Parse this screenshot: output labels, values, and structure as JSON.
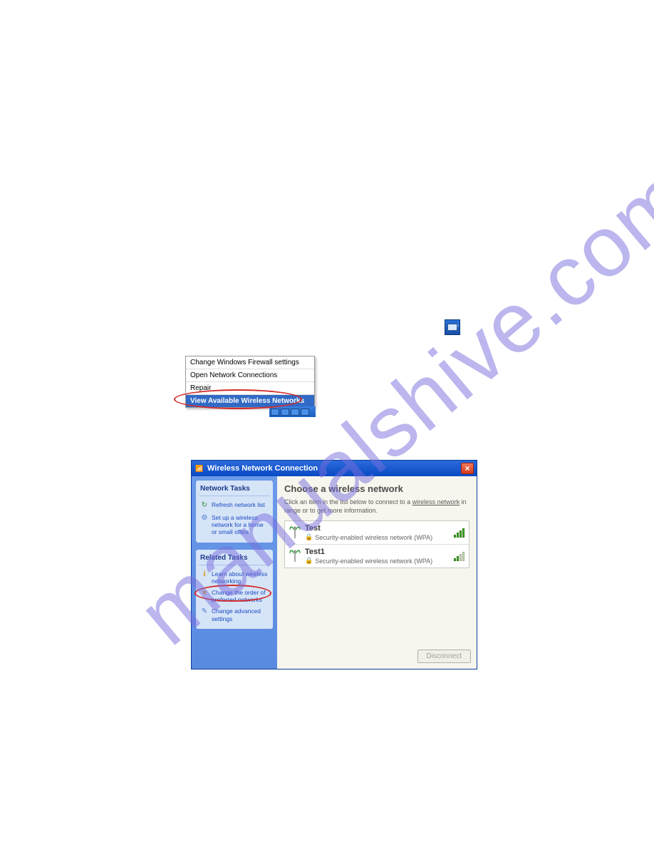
{
  "tray_icon": {
    "name": "wireless-tray-icon"
  },
  "context_menu": {
    "items": [
      {
        "label": "Change Windows Firewall settings",
        "selected": false
      },
      {
        "label": "Open Network Connections",
        "selected": false
      },
      {
        "label": "Repair",
        "selected": false
      },
      {
        "label": "View Available Wireless Networks",
        "selected": true
      }
    ]
  },
  "dialog": {
    "title": "Wireless Network Connection",
    "close_label": "×",
    "sidebar": {
      "network_tasks_title": "Network Tasks",
      "network_tasks": [
        {
          "icon": "refresh-icon",
          "label": "Refresh network list"
        },
        {
          "icon": "setup-icon",
          "label": "Set up a wireless network for a home or small office"
        }
      ],
      "related_tasks_title": "Related Tasks",
      "related_tasks": [
        {
          "icon": "info-icon",
          "label": "Learn about wireless networking"
        },
        {
          "icon": "star-icon",
          "label": "Change the order of preferred networks",
          "highlighted": true
        },
        {
          "icon": "gear-icon",
          "label": "Change advanced settings"
        }
      ]
    },
    "main": {
      "heading": "Choose a wireless network",
      "description_pre": "Click an item in the list below to connect to a ",
      "description_link": "wireless network",
      "description_post": " in range or to get more information.",
      "networks": [
        {
          "name": "Test",
          "security": "Security-enabled wireless network (WPA)",
          "strength": "full"
        },
        {
          "name": "Test1",
          "security": "Security-enabled wireless network (WPA)",
          "strength": "weak"
        }
      ],
      "disconnect_label": "Disconnect"
    }
  }
}
